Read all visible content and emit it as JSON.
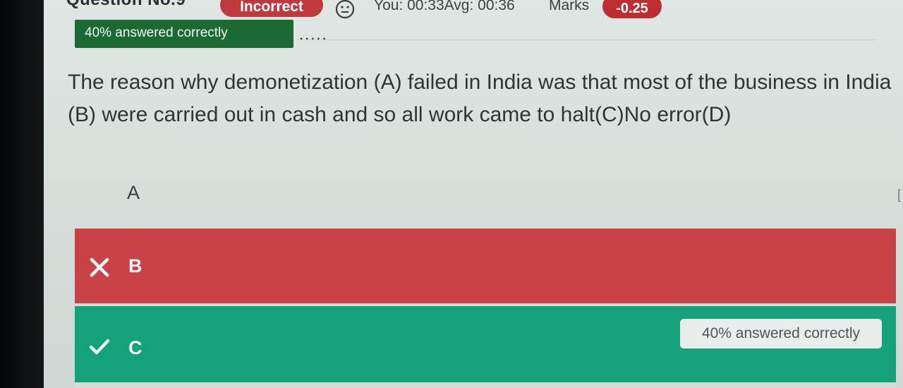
{
  "header": {
    "question_number": "Question No.9",
    "status_badge": "Incorrect",
    "status_icon": "neutral-face-icon",
    "time_text": "You: 00:33Avg: 00:36",
    "marks_label": "Marks",
    "marks_value": "-0.25"
  },
  "tag": {
    "label": "40% answered correctly",
    "trailing": "....."
  },
  "question": {
    "text": "The reason why demonetization (A) failed in India was that most of the business in India (B) were carried out in cash and so all work came to halt(C)No error(D)"
  },
  "options": [
    {
      "letter": "A",
      "state": "neutral"
    },
    {
      "letter": "B",
      "state": "wrong",
      "icon": "cross-icon"
    },
    {
      "letter": "C",
      "state": "correct",
      "icon": "check-icon",
      "note": "40% answered correctly"
    }
  ],
  "edge_mark": "[",
  "colors": {
    "incorrect": "#c0393f",
    "wrong_option": "#c84248",
    "correct_option": "#15a17a",
    "tag_green": "#1b6a34"
  }
}
